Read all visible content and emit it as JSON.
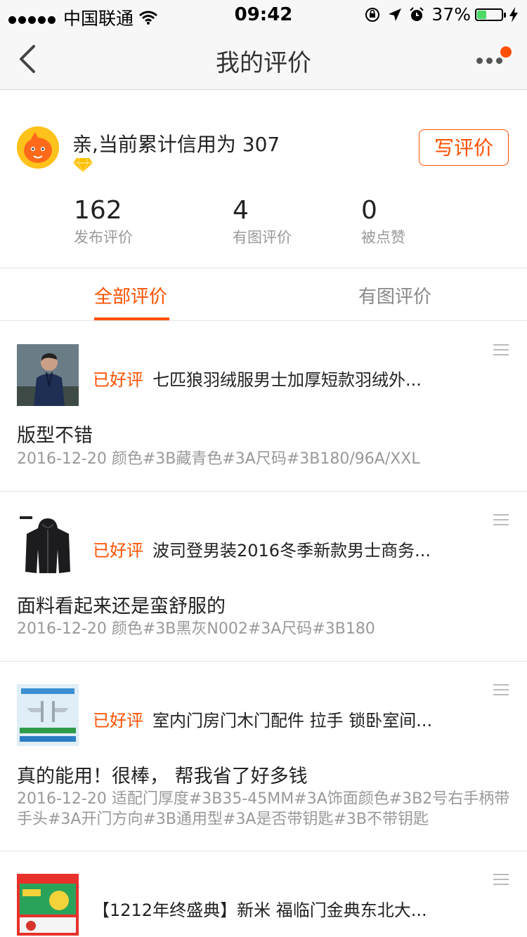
{
  "status_bar": {
    "carrier": "中国联通",
    "time": "09:42",
    "battery": "37%",
    "battery_level": 0.37
  },
  "nav": {
    "title": "我的评价"
  },
  "profile": {
    "credit_text": "亲,当前累计信用为 307",
    "write_button": "写评价"
  },
  "stats": [
    {
      "value": "162",
      "label": "发布评价"
    },
    {
      "value": "4",
      "label": "有图评价"
    },
    {
      "value": "0",
      "label": "被点赞"
    }
  ],
  "tabs": [
    {
      "label": "全部评价"
    },
    {
      "label": "有图评价"
    }
  ],
  "reviews": [
    {
      "rating": "已好评",
      "title": "七匹狼羽绒服男士加厚短款羽绒外...",
      "comment": "版型不错",
      "spec": "2016-12-20 颜色#3B藏青色#3A尺码#3B180/96A/XXL"
    },
    {
      "rating": "已好评",
      "title": "波司登男装2016冬季新款男士商务...",
      "comment": "面料看起来还是蛮舒服的",
      "spec": "2016-12-20 颜色#3B黑灰N002#3A尺码#3B180"
    },
    {
      "rating": "已好评",
      "title": "室内门房门木门配件 拉手 锁卧室间...",
      "comment": "真的能用！很棒， 帮我省了好多钱",
      "spec": "2016-12-20 适配门厚度#3B35-45MM#3A饰面颜色#3B2号右手柄带手头#3A开门方向#3B通用型#3A是否带钥匙#3B不带钥匙"
    },
    {
      "rating": "",
      "title": "【1212年终盛典】新米 福临门金典东北大...",
      "comment": "",
      "spec": ""
    }
  ],
  "colors": {
    "accent": "#ff5000",
    "muted_text": "#999999",
    "divider": "#e5e5e5"
  },
  "icons": [
    "back-arrow-icon",
    "more-dots-icon",
    "diamond-icon",
    "list-menu-icon",
    "wifi-icon",
    "location-arrow-icon",
    "alarm-icon",
    "lock-rotation-icon",
    "charging-bolt-icon"
  ]
}
